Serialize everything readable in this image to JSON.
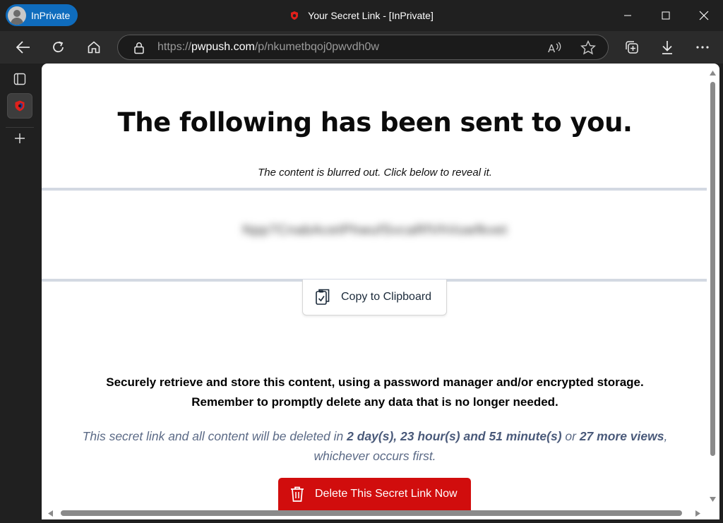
{
  "titlebar": {
    "profile_label": "InPrivate",
    "window_title": "Your Secret Link - [InPrivate]"
  },
  "addressbar": {
    "url_scheme": "https://",
    "url_host": "pwpush.com",
    "url_path": "/p/nkumetbqoj0pwvdh0w"
  },
  "page": {
    "heading": "The following has been sent to you.",
    "subtext": "The content is blurred out. Click below to reveal it.",
    "blurred_secret": "Npp7CnabAcetPhwufSvcaRfVhVuwfkvet",
    "copy_label": "Copy to Clipboard",
    "notice_line1": "Securely retrieve and store this content, using a password manager and/or encrypted storage.",
    "notice_line2": "Remember to promptly delete any data that is no longer needed.",
    "expiry_prefix": "This secret link and all content will be deleted in ",
    "expiry_time": "2 day(s), 23 hour(s) and 51 minute(s)",
    "expiry_or": " or ",
    "expiry_views": "27 more views",
    "expiry_suffix": ", whichever occurs first.",
    "delete_label": "Delete This Secret Link Now"
  },
  "icons": [
    "back-icon",
    "refresh-icon",
    "home-icon",
    "lock-icon",
    "read-aloud-icon",
    "favorite-star-icon",
    "collections-icon",
    "download-icon",
    "more-icon",
    "minimize-icon",
    "maximize-icon",
    "close-icon",
    "tab-actions-icon",
    "pwpush-icon",
    "add-icon",
    "clipboard-icon",
    "trash-icon"
  ],
  "colors": {
    "inprivate_pill": "#0f6cbd",
    "delete_button": "#d10d0d",
    "expiry_text": "#5b6a86",
    "rule": "#d3d9e2"
  }
}
